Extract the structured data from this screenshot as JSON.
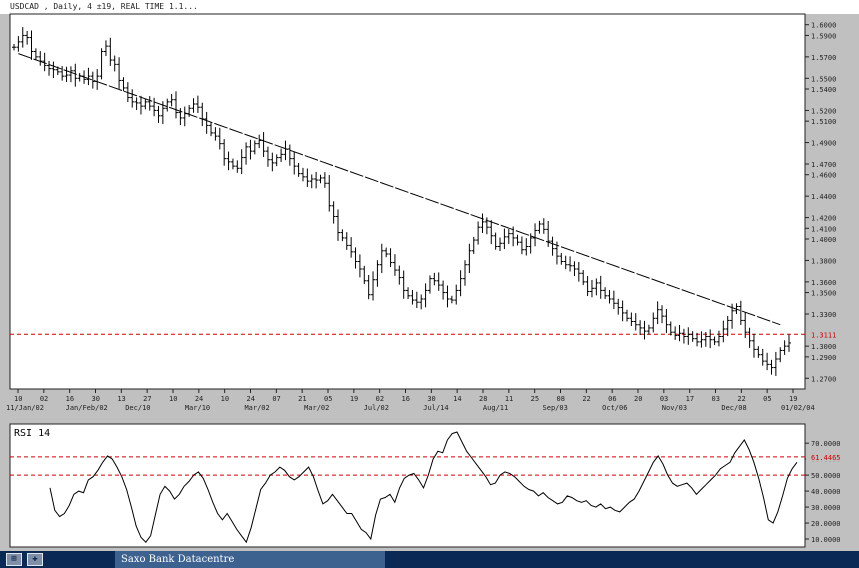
{
  "window": {
    "title": "USDCAD , Daily, 4 ±19, REAL TIME 1.1..."
  },
  "taskbar": {
    "item_label": "Saxo Bank Datacentre",
    "btn1_glyph": "⊞",
    "btn2_glyph": "✚"
  },
  "colors": {
    "ref_line": "#cc0000",
    "candle": "#000000",
    "chart_bg": "#ffffff",
    "frame_bg": "#c0c0c0"
  },
  "chart_data": [
    {
      "type": "ohlc",
      "symbol": "USDCAD",
      "price_axis": {
        "ylim": [
          1.26,
          1.61
        ],
        "ticks": [
          "1.6000",
          "1.5900",
          "1.5700",
          "1.5500",
          "1.5400",
          "1.5200",
          "1.5100",
          "1.4900",
          "1.4700",
          "1.4600",
          "1.4400",
          "1.4200",
          "1.4100",
          "1.4000",
          "1.3800",
          "1.3600",
          "1.3500",
          "1.3300",
          "1.3000",
          "1.2900",
          "1.2700"
        ],
        "tick_values": [
          1.6,
          1.59,
          1.57,
          1.55,
          1.54,
          1.52,
          1.51,
          1.49,
          1.47,
          1.46,
          1.44,
          1.42,
          1.41,
          1.4,
          1.38,
          1.36,
          1.35,
          1.33,
          1.3,
          1.29,
          1.27
        ]
      },
      "date_axis": {
        "days": [
          "10",
          "02",
          "16",
          "30",
          "13",
          "27",
          "10",
          "24",
          "10",
          "24",
          "07",
          "21",
          "05",
          "19",
          "02",
          "16",
          "30",
          "14",
          "28",
          "11",
          "25",
          "08",
          "22",
          "06",
          "20",
          "03",
          "17",
          "03",
          "22",
          "05",
          "19"
        ],
        "months": [
          "11/Jan/02",
          "Jan/Feb/02",
          "Dec/10",
          "Mar/10",
          "Mar/02",
          "Mar/02",
          "Jul/02",
          "Jul/14",
          "Aug/11",
          "Sep/03",
          "Oct/06",
          "Nov/03",
          "Dec/08",
          "01/02/04"
        ]
      },
      "reference_line": {
        "value": 1.3111,
        "label": "1.3111"
      },
      "trendline": {
        "from": [
          1,
          1.573
        ],
        "to": [
          175,
          1.32
        ]
      },
      "closes": [
        1.579,
        1.584,
        1.59,
        1.588,
        1.575,
        1.57,
        1.566,
        1.562,
        1.559,
        1.558,
        1.556,
        1.552,
        1.553,
        1.557,
        1.55,
        1.552,
        1.549,
        1.552,
        1.547,
        1.552,
        1.575,
        1.58,
        1.567,
        1.563,
        1.548,
        1.541,
        1.532,
        1.528,
        1.527,
        1.524,
        1.528,
        1.524,
        1.52,
        1.515,
        1.522,
        1.528,
        1.53,
        1.518,
        1.513,
        1.517,
        1.522,
        1.526,
        1.523,
        1.512,
        1.506,
        1.499,
        1.496,
        1.489,
        1.475,
        1.472,
        1.468,
        1.466,
        1.476,
        1.486,
        1.482,
        1.489,
        1.492,
        1.482,
        1.474,
        1.471,
        1.476,
        1.479,
        1.484,
        1.475,
        1.468,
        1.461,
        1.458,
        1.454,
        1.456,
        1.455,
        1.457,
        1.452,
        1.431,
        1.421,
        1.406,
        1.401,
        1.394,
        1.388,
        1.379,
        1.372,
        1.361,
        1.348,
        1.362,
        1.376,
        1.389,
        1.386,
        1.378,
        1.371,
        1.364,
        1.352,
        1.347,
        1.343,
        1.341,
        1.344,
        1.352,
        1.363,
        1.361,
        1.357,
        1.35,
        1.344,
        1.343,
        1.352,
        1.363,
        1.376,
        1.389,
        1.399,
        1.411,
        1.416,
        1.411,
        1.403,
        1.393,
        1.396,
        1.402,
        1.405,
        1.401,
        1.397,
        1.39,
        1.393,
        1.401,
        1.408,
        1.414,
        1.409,
        1.398,
        1.391,
        1.384,
        1.379,
        1.376,
        1.375,
        1.372,
        1.368,
        1.36,
        1.351,
        1.354,
        1.359,
        1.352,
        1.347,
        1.344,
        1.34,
        1.336,
        1.331,
        1.326,
        1.323,
        1.32,
        1.317,
        1.314,
        1.317,
        1.326,
        1.334,
        1.328,
        1.32,
        1.313,
        1.31,
        1.312,
        1.309,
        1.311,
        1.307,
        1.304,
        1.306,
        1.309,
        1.306,
        1.304,
        1.309,
        1.316,
        1.324,
        1.333,
        1.337,
        1.324,
        1.313,
        1.305,
        1.297,
        1.292,
        1.286,
        1.283,
        1.28,
        1.288,
        1.296,
        1.3,
        1.303
      ],
      "rsi": {
        "title": "RSI 14",
        "ylim": [
          5,
          82
        ],
        "ticks": [
          "70.0000",
          "60.0000",
          "50.0000",
          "40.0000",
          "30.0000",
          "20.0000",
          "10.0000"
        ],
        "tick_values": [
          70,
          60,
          50,
          40,
          30,
          20,
          10
        ],
        "levels": [
          61.4465,
          50
        ],
        "level_labels": [
          "61.4465",
          ""
        ],
        "values": [
          42,
          28,
          24,
          26,
          31,
          38,
          40,
          39,
          47,
          49,
          53,
          58,
          62,
          60,
          55,
          49,
          41,
          30,
          18,
          11,
          8,
          12,
          25,
          38,
          43,
          40,
          35,
          38,
          43,
          46,
          50,
          52,
          48,
          41,
          33,
          26,
          22,
          26,
          21,
          16,
          12,
          8,
          17,
          29,
          41,
          45,
          50,
          52,
          55,
          53,
          49,
          47,
          49,
          52,
          55,
          49,
          40,
          32,
          34,
          38,
          34,
          30,
          26,
          26,
          21,
          16,
          14,
          10,
          25,
          35,
          36,
          38,
          33,
          42,
          48,
          50,
          51,
          47,
          42,
          50,
          60,
          65,
          64,
          72,
          76,
          77,
          71,
          65,
          61,
          57,
          53,
          49,
          44,
          45,
          50,
          52,
          51,
          49,
          46,
          43,
          41,
          40,
          37,
          39,
          36,
          34,
          32,
          33,
          37,
          36,
          34,
          33,
          34,
          31,
          30,
          32,
          29,
          30,
          28,
          27,
          30,
          33,
          35,
          40,
          46,
          52,
          58,
          62,
          57,
          50,
          45,
          43,
          44,
          45,
          42,
          38,
          41,
          44,
          47,
          50,
          54,
          56,
          58,
          64,
          68,
          72,
          66,
          58,
          48,
          36,
          22,
          20,
          27,
          37,
          48,
          54,
          58
        ]
      }
    }
  ]
}
